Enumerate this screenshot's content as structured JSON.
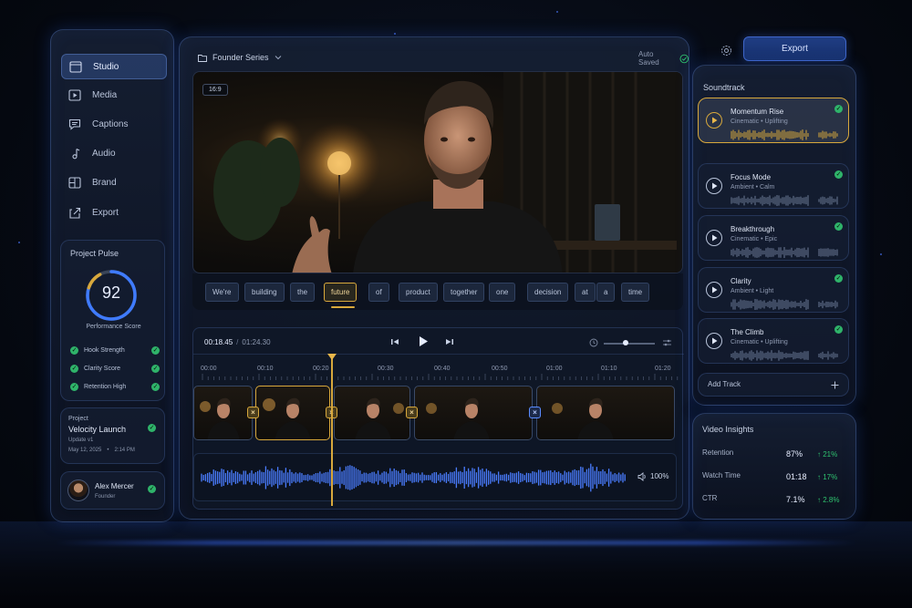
{
  "sidebar": {
    "items": [
      {
        "label": "Studio",
        "icon": "window-icon",
        "active": true
      },
      {
        "label": "Media",
        "icon": "play-square-icon"
      },
      {
        "label": "Captions",
        "icon": "caption-icon"
      },
      {
        "label": "Audio",
        "icon": "music-note-icon"
      },
      {
        "label": "Brand",
        "icon": "brand-icon"
      },
      {
        "label": "Export",
        "icon": "export-icon"
      }
    ]
  },
  "pulse": {
    "title": "Project Pulse",
    "score": "92",
    "score_fraction": 0.92,
    "score_label": "Performance Score",
    "metrics": [
      "Hook Strength",
      "Clarity Score",
      "Retention High"
    ]
  },
  "project": {
    "label": "Project",
    "name": "Velocity Launch",
    "version": "Update v1",
    "date": "May 12, 2025",
    "time": "2:14 PM"
  },
  "user": {
    "name": "Alex Mercer",
    "role": "Founder"
  },
  "header": {
    "series": "Founder Series",
    "autosave": "Auto Saved",
    "export_label": "Export"
  },
  "video": {
    "ratio": "16:9"
  },
  "captions": {
    "words": [
      "We're",
      "building",
      "the",
      "future",
      "of",
      "product",
      "together",
      "one",
      "decision",
      "at",
      "a",
      "time"
    ],
    "highlight": "future"
  },
  "timeline": {
    "current": "00:18.45",
    "separator": "/",
    "total": "01:24.30",
    "ticks": [
      "00:00",
      "00:10",
      "00:20",
      "00:30",
      "00:40",
      "00:50",
      "01:00",
      "01:10",
      "01:20"
    ],
    "volume": "100%"
  },
  "soundtrack": {
    "title": "Soundtrack",
    "tracks": [
      {
        "title": "Momentum Rise",
        "sub": "Cinematic • Uplifting",
        "active": true
      },
      {
        "title": "Focus Mode",
        "sub": "Ambient • Calm"
      },
      {
        "title": "Breakthrough",
        "sub": "Cinematic • Epic"
      },
      {
        "title": "Clarity",
        "sub": "Ambient • Light"
      },
      {
        "title": "The Climb",
        "sub": "Cinematic • Uplifting"
      }
    ],
    "add_label": "Add Track"
  },
  "insights": {
    "title": "Video Insights",
    "rows": [
      {
        "label": "Retention",
        "value": "87%",
        "change": "↑ 21%"
      },
      {
        "label": "Watch Time",
        "value": "01:18",
        "change": "↑ 17%"
      },
      {
        "label": "CTR",
        "value": "7.1%",
        "change": "↑ 2.8%"
      }
    ]
  },
  "colors": {
    "accent": "#3a6cff",
    "highlight": "#d8a83c",
    "success": "#2fb36a"
  }
}
